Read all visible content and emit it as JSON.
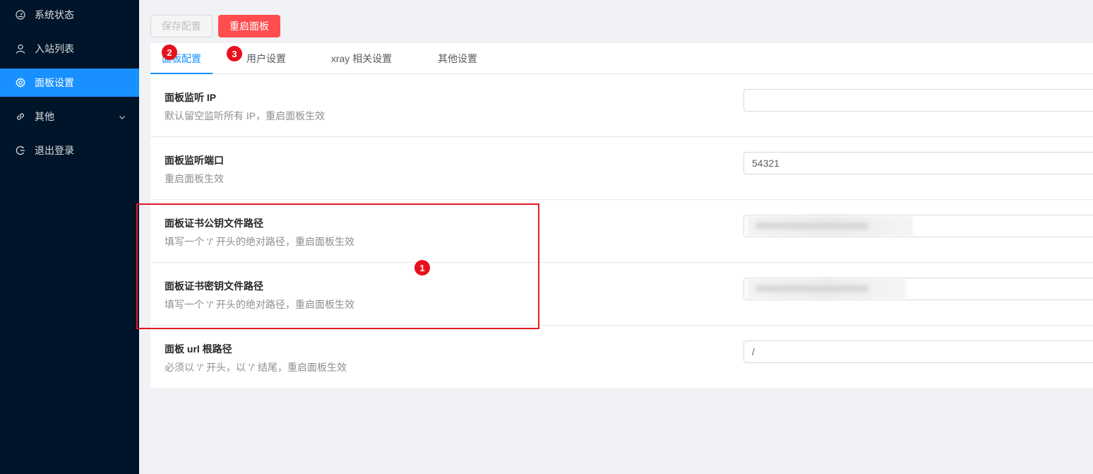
{
  "sidebar": {
    "items": [
      {
        "label": "系统状态",
        "icon": "dashboard-icon"
      },
      {
        "label": "入站列表",
        "icon": "user-icon"
      },
      {
        "label": "面板设置",
        "icon": "gear-icon",
        "active": true
      },
      {
        "label": "其他",
        "icon": "link-icon"
      },
      {
        "label": "退出登录",
        "icon": "logout-icon"
      }
    ]
  },
  "toolbar": {
    "save_label": "保存配置",
    "restart_label": "重启面板"
  },
  "tabs": [
    {
      "label": "面板配置",
      "active": true
    },
    {
      "label": "用户设置"
    },
    {
      "label": "xray 相关设置"
    },
    {
      "label": "其他设置"
    }
  ],
  "settings": [
    {
      "title": "面板监听 IP",
      "desc": "默认留空监听所有 IP，重启面板生效",
      "value": ""
    },
    {
      "title": "面板监听端口",
      "desc": "重启面板生效",
      "value": "54321"
    },
    {
      "title": "面板证书公钥文件路径",
      "desc": "填写一个 '/' 开头的绝对路径，重启面板生效",
      "value": ""
    },
    {
      "title": "面板证书密钥文件路径",
      "desc": "填写一个 '/' 开头的绝对路径，重启面板生效",
      "value": ""
    },
    {
      "title": "面板 url 根路径",
      "desc": "必须以 '/' 开头，以 '/' 结尾，重启面板生效",
      "value": "/"
    }
  ],
  "annotations": [
    "1",
    "2",
    "3"
  ],
  "colors": {
    "sidebar_bg": "#001529",
    "accent": "#1890ff",
    "danger": "#ff4d4f",
    "annotation_red": "#e01b24"
  }
}
